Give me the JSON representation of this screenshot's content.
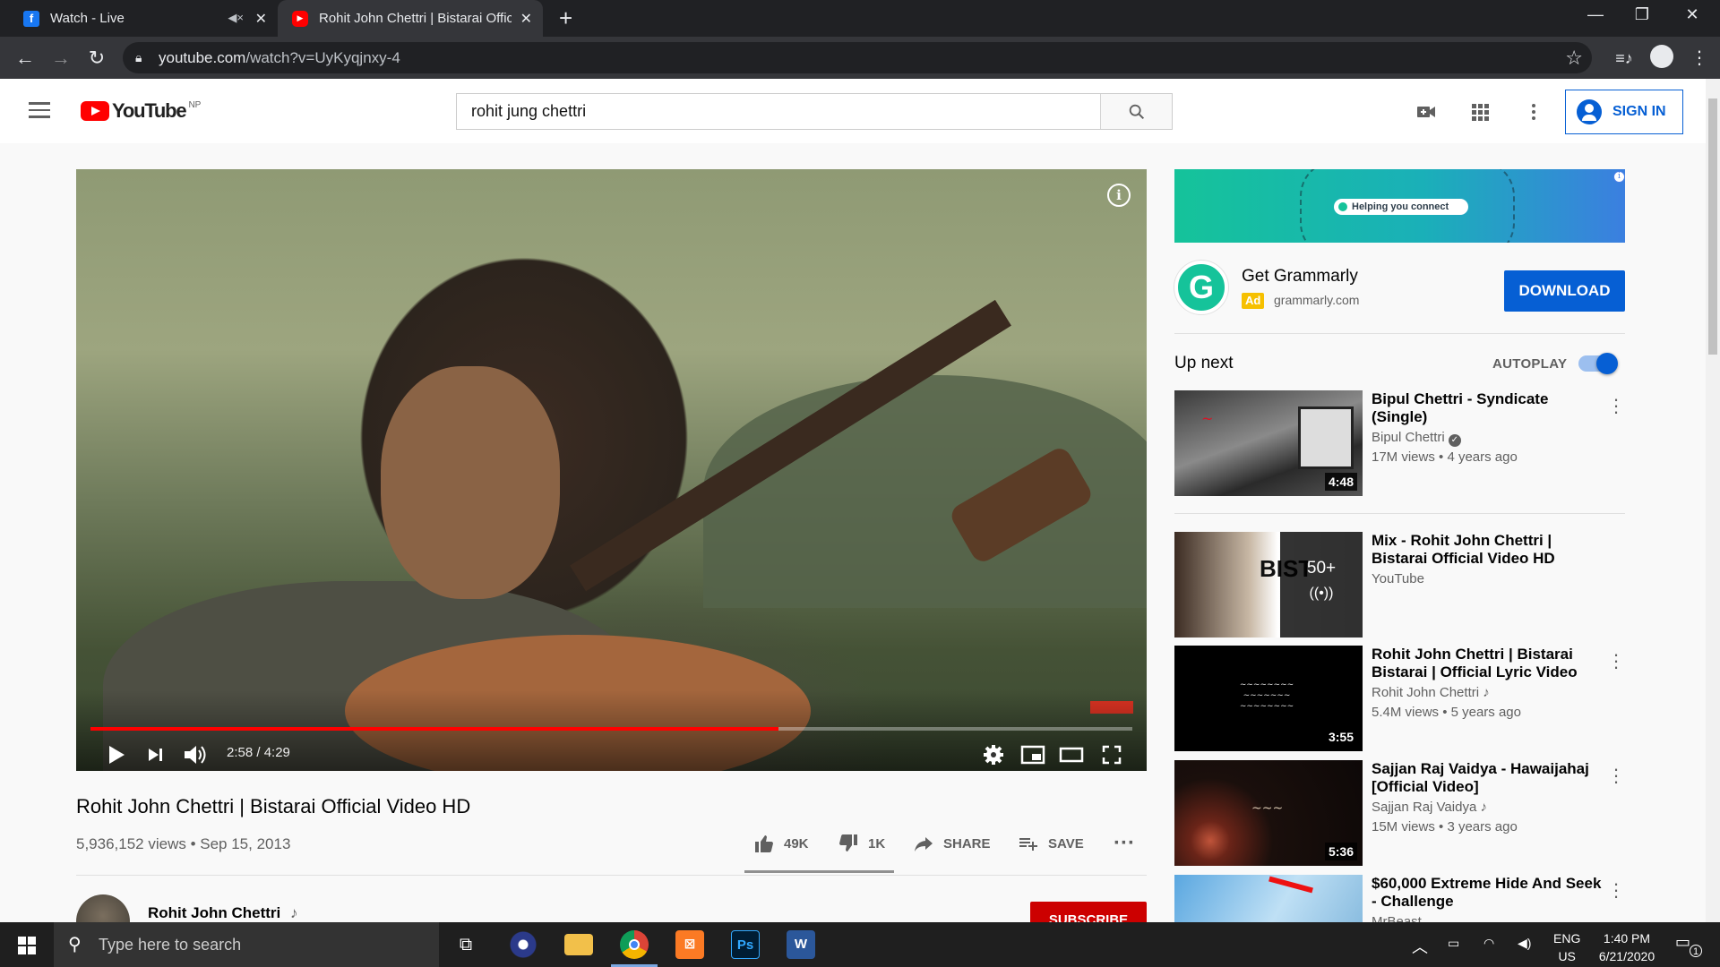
{
  "browser": {
    "tabs": [
      {
        "title": "Watch - Live",
        "favicon": "facebook-icon",
        "active": false
      },
      {
        "title": "Rohit John Chettri | Bistarai Official Video HD",
        "favicon": "youtube-icon",
        "active": true
      }
    ],
    "url_host": "youtube.com",
    "url_path": "/watch?v=UyKyqjnxy-4"
  },
  "masthead": {
    "logo_text": "YouTube",
    "region": "NP",
    "search_value": "rohit jung chettri",
    "sign_in_label": "SIGN IN"
  },
  "player": {
    "current_time": "2:58",
    "duration": "4:29",
    "time_display": "2:58 / 4:29",
    "progress_fraction": 0.66,
    "info_glyph": "i"
  },
  "video": {
    "title": "Rohit John Chettri | Bistarai Official Video HD",
    "views_date": "5,936,152 views • Sep 15, 2013",
    "likes": "49K",
    "dislikes": "1K",
    "share_label": "SHARE",
    "save_label": "SAVE",
    "channel_name": "Rohit John Chettri",
    "subscribe_label": "SUBSCRIBE"
  },
  "ad": {
    "banner_text": "Helping you connect",
    "title": "Get Grammarly",
    "badge": "Ad",
    "domain": "grammarly.com",
    "cta": "DOWNLOAD",
    "logo_letter": "G"
  },
  "upnext": {
    "label": "Up next",
    "autoplay_label": "AUTOPLAY",
    "autoplay_on": true,
    "items": [
      {
        "title": "Bipul Chettri - Syndicate (Single)",
        "channel": "Bipul Chettri",
        "verified": true,
        "meta": "17M views • 4 years ago",
        "duration": "4:48"
      },
      {
        "title": "Mix - Rohit John Chettri | Bistarai Official Video HD",
        "channel": "YouTube",
        "meta": "",
        "mix_count": "50+"
      },
      {
        "title": "Rohit John Chettri | Bistarai Bistarai | Official Lyric Video",
        "channel": "Rohit John Chettri",
        "music_note": true,
        "meta": "5.4M views • 5 years ago",
        "duration": "3:55"
      },
      {
        "title": "Sajjan Raj Vaidya - Hawaijahaj [Official Video]",
        "channel": "Sajjan Raj Vaidya",
        "music_note": true,
        "meta": "15M views • 3 years ago",
        "duration": "5:36"
      },
      {
        "title": "$60,000 Extreme Hide And Seek - Challenge",
        "channel": "MrBeast",
        "meta": ""
      }
    ]
  },
  "taskbar": {
    "search_placeholder": "Type here to search",
    "lang": "ENG",
    "region": "US",
    "time": "1:40 PM",
    "date": "6/21/2020",
    "notifications": "1"
  },
  "colors": {
    "youtube_red": "#ff0000",
    "link_blue": "#065fd4",
    "grammarly_green": "#15c39a"
  }
}
